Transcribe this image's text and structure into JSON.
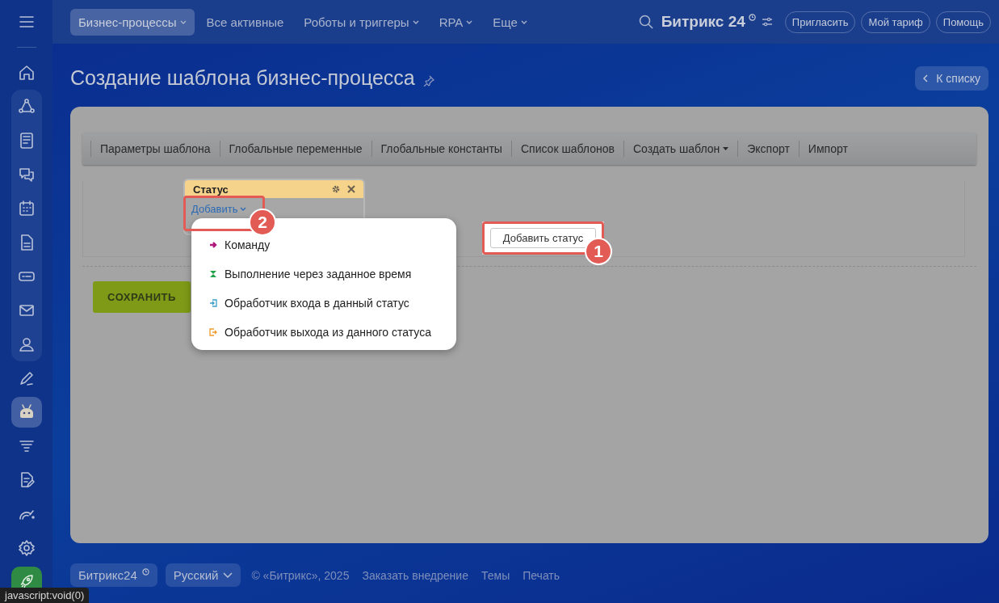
{
  "sidebar": {
    "items": [
      {
        "selected": false
      },
      {
        "selected": false
      },
      {
        "selected": false
      },
      {
        "selected": false
      },
      {
        "selected": false
      },
      {
        "selected": false
      },
      {
        "selected": false
      },
      {
        "selected": false
      },
      {
        "selected": false
      },
      {
        "selected": false
      },
      {
        "selected": false
      },
      {
        "selected": true
      },
      {
        "selected": false
      },
      {
        "selected": false
      },
      {
        "selected": false
      },
      {
        "selected": false
      },
      {
        "selected": false
      }
    ]
  },
  "top_nav": {
    "items": [
      {
        "label": "Бизнес-процессы",
        "selected": true,
        "has_menu": true
      },
      {
        "label": "Все активные",
        "selected": false,
        "has_menu": false
      },
      {
        "label": "Роботы и триггеры",
        "selected": false,
        "has_menu": true
      },
      {
        "label": "RPA",
        "selected": false,
        "has_menu": true
      },
      {
        "label": "Еще",
        "selected": false,
        "has_menu": true
      }
    ],
    "brand": "Битрикс 24",
    "buttons": [
      "Пригласить",
      "Мой тариф",
      "Помощь"
    ]
  },
  "page_title": "Создание шаблона бизнес-процесса",
  "back_button": "К списку",
  "toolbar": {
    "items": [
      {
        "label": "Параметры шаблона",
        "has_menu": false
      },
      {
        "label": "Глобальные переменные",
        "has_menu": false
      },
      {
        "label": "Глобальные константы",
        "has_menu": false
      },
      {
        "label": "Список шаблонов",
        "has_menu": false
      },
      {
        "label": "Создать шаблон",
        "has_menu": true
      },
      {
        "label": "Экспорт",
        "has_menu": false
      },
      {
        "label": "Импорт",
        "has_menu": false
      }
    ]
  },
  "status_block": {
    "title": "Статус",
    "add_link": "Добавить"
  },
  "add_menu": {
    "items": [
      {
        "label": "Команду",
        "kind": "command"
      },
      {
        "label": "Выполнение через заданное время",
        "kind": "delay"
      },
      {
        "label": "Обработчик входа в данный статус",
        "kind": "enter"
      },
      {
        "label": "Обработчик выхода из данного статуса",
        "kind": "exit"
      }
    ]
  },
  "add_status_button": "Добавить статус",
  "save_button": "СОХРАНИТЬ",
  "callouts": [
    "1",
    "2"
  ],
  "footer": {
    "brand": "Битрикс24",
    "language": "Русский",
    "copyright": "© «Битрикс», 2025",
    "links": [
      "Заказать внедрение",
      "Темы",
      "Печать"
    ]
  },
  "status_bar": "javascript:void(0)"
}
